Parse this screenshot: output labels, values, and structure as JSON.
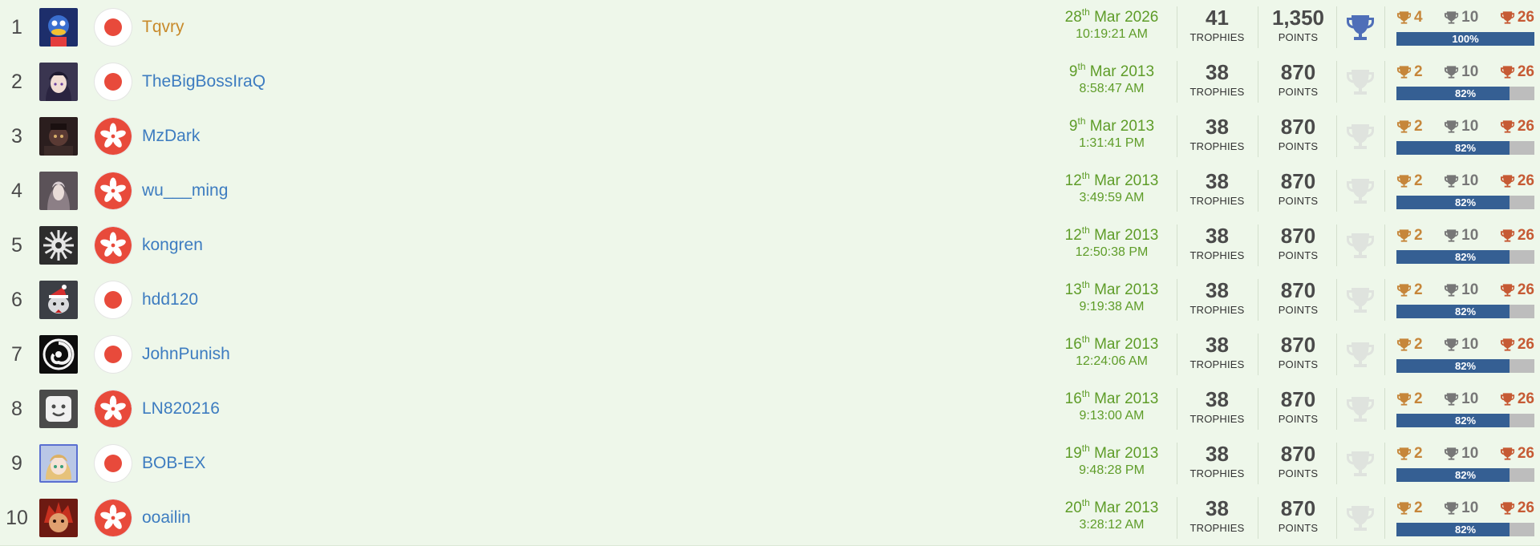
{
  "colors": {
    "background": "#eef7ea",
    "username": "#3d7cc0",
    "username_top": "#c88a2a",
    "date": "#5e9c28",
    "progress_fill": "#355f93",
    "progress_track": "#bdbdbd",
    "platinum_earned": "#4f6fb8",
    "platinum_unearned": "#dfe3de",
    "gold_trophy": "#c6863a",
    "silver_trophy": "#777777",
    "bronze_trophy": "#c65a34",
    "flag_red": "#e84a3b"
  },
  "labels": {
    "trophies": "TROPHIES",
    "points": "POINTS"
  },
  "rows": [
    {
      "rank": "1",
      "avatar": "blue-duck-avatar",
      "flag": "japan-flag-icon",
      "username": "Tqvry",
      "top": true,
      "date_day": "28",
      "date_suffix": "th",
      "date_rest": "Mar 2026",
      "time": "10:19:21 AM",
      "trophies": "41",
      "points": "1,350",
      "platinum": true,
      "gold": "4",
      "silver": "10",
      "bronze": "26",
      "progress": 100,
      "progress_label": "100%"
    },
    {
      "rank": "2",
      "avatar": "anime-girl-avatar",
      "flag": "japan-flag-icon",
      "username": "TheBigBossIraQ",
      "top": false,
      "date_day": "9",
      "date_suffix": "th",
      "date_rest": "Mar 2013",
      "time": "8:58:47 AM",
      "trophies": "38",
      "points": "870",
      "platinum": false,
      "gold": "2",
      "silver": "10",
      "bronze": "26",
      "progress": 82,
      "progress_label": "82%"
    },
    {
      "rank": "3",
      "avatar": "dark-character-avatar",
      "flag": "hong-kong-flag-icon",
      "username": "MzDark",
      "top": false,
      "date_day": "9",
      "date_suffix": "th",
      "date_rest": "Mar 2013",
      "time": "1:31:41 PM",
      "trophies": "38",
      "points": "870",
      "platinum": false,
      "gold": "2",
      "silver": "10",
      "bronze": "26",
      "progress": 82,
      "progress_label": "82%"
    },
    {
      "rank": "4",
      "avatar": "hooded-figure-avatar",
      "flag": "hong-kong-flag-icon",
      "username": "wu___ming",
      "top": false,
      "date_day": "12",
      "date_suffix": "th",
      "date_rest": "Mar 2013",
      "time": "3:49:59 AM",
      "trophies": "38",
      "points": "870",
      "platinum": false,
      "gold": "2",
      "silver": "10",
      "bronze": "26",
      "progress": 82,
      "progress_label": "82%"
    },
    {
      "rank": "5",
      "avatar": "gear-emblem-avatar",
      "flag": "hong-kong-flag-icon",
      "username": "kongren",
      "top": false,
      "date_day": "12",
      "date_suffix": "th",
      "date_rest": "Mar 2013",
      "time": "12:50:38 PM",
      "trophies": "38",
      "points": "870",
      "platinum": false,
      "gold": "2",
      "silver": "10",
      "bronze": "26",
      "progress": 82,
      "progress_label": "82%"
    },
    {
      "rank": "6",
      "avatar": "santa-cat-avatar",
      "flag": "japan-flag-icon",
      "username": "hdd120",
      "top": false,
      "date_day": "13",
      "date_suffix": "th",
      "date_rest": "Mar 2013",
      "time": "9:19:38 AM",
      "trophies": "38",
      "points": "870",
      "platinum": false,
      "gold": "2",
      "silver": "10",
      "bronze": "26",
      "progress": 82,
      "progress_label": "82%"
    },
    {
      "rank": "7",
      "avatar": "spiral-avatar",
      "flag": "japan-flag-icon",
      "username": "JohnPunish",
      "top": false,
      "date_day": "16",
      "date_suffix": "th",
      "date_rest": "Mar 2013",
      "time": "12:24:06 AM",
      "trophies": "38",
      "points": "870",
      "platinum": false,
      "gold": "2",
      "silver": "10",
      "bronze": "26",
      "progress": 82,
      "progress_label": "82%"
    },
    {
      "rank": "8",
      "avatar": "smiley-block-avatar",
      "flag": "hong-kong-flag-icon",
      "username": "LN820216",
      "top": false,
      "date_day": "16",
      "date_suffix": "th",
      "date_rest": "Mar 2013",
      "time": "9:13:00 AM",
      "trophies": "38",
      "points": "870",
      "platinum": false,
      "gold": "2",
      "silver": "10",
      "bronze": "26",
      "progress": 82,
      "progress_label": "82%"
    },
    {
      "rank": "9",
      "avatar": "blonde-anime-avatar",
      "flag": "japan-flag-icon",
      "username": "BOB-EX",
      "top": false,
      "date_day": "19",
      "date_suffix": "th",
      "date_rest": "Mar 2013",
      "time": "9:48:28 PM",
      "trophies": "38",
      "points": "870",
      "platinum": false,
      "gold": "2",
      "silver": "10",
      "bronze": "26",
      "progress": 82,
      "progress_label": "82%"
    },
    {
      "rank": "10",
      "avatar": "red-monkey-avatar",
      "flag": "hong-kong-flag-icon",
      "username": "ooailin",
      "top": false,
      "date_day": "20",
      "date_suffix": "th",
      "date_rest": "Mar 2013",
      "time": "3:28:12 AM",
      "trophies": "38",
      "points": "870",
      "platinum": false,
      "gold": "2",
      "silver": "10",
      "bronze": "26",
      "progress": 82,
      "progress_label": "82%"
    }
  ]
}
